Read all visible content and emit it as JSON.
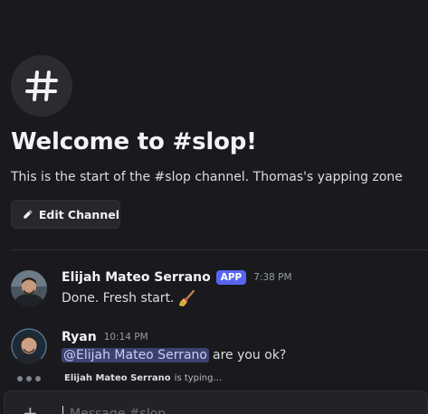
{
  "channel": {
    "hero_icon": "hash-icon",
    "welcome_title": "Welcome to #slop!",
    "welcome_subtitle": "This is the start of the #slop channel. Thomas's yapping zone",
    "edit_button_label": "Edit Channel",
    "edit_button_icon": "pencil-icon"
  },
  "messages": [
    {
      "author": "Elijah Mateo Serrano",
      "badge": "APP",
      "time": "7:38 PM",
      "text": "Done. Fresh start.",
      "emoji": "broom-icon"
    },
    {
      "author": "Ryan",
      "time": "10:14 PM",
      "mention": "@Elijah Mateo Serrano",
      "text": "are you ok?"
    }
  ],
  "typing": {
    "who": "Elijah Mateo Serrano",
    "rest": "is typing..."
  },
  "composer": {
    "placeholder": "Message #slop"
  },
  "colors": {
    "background": "#1a1a1e",
    "app_badge": "#5865f2",
    "mention_bg": "#3c4270",
    "mention_text": "#c9cdfb"
  }
}
